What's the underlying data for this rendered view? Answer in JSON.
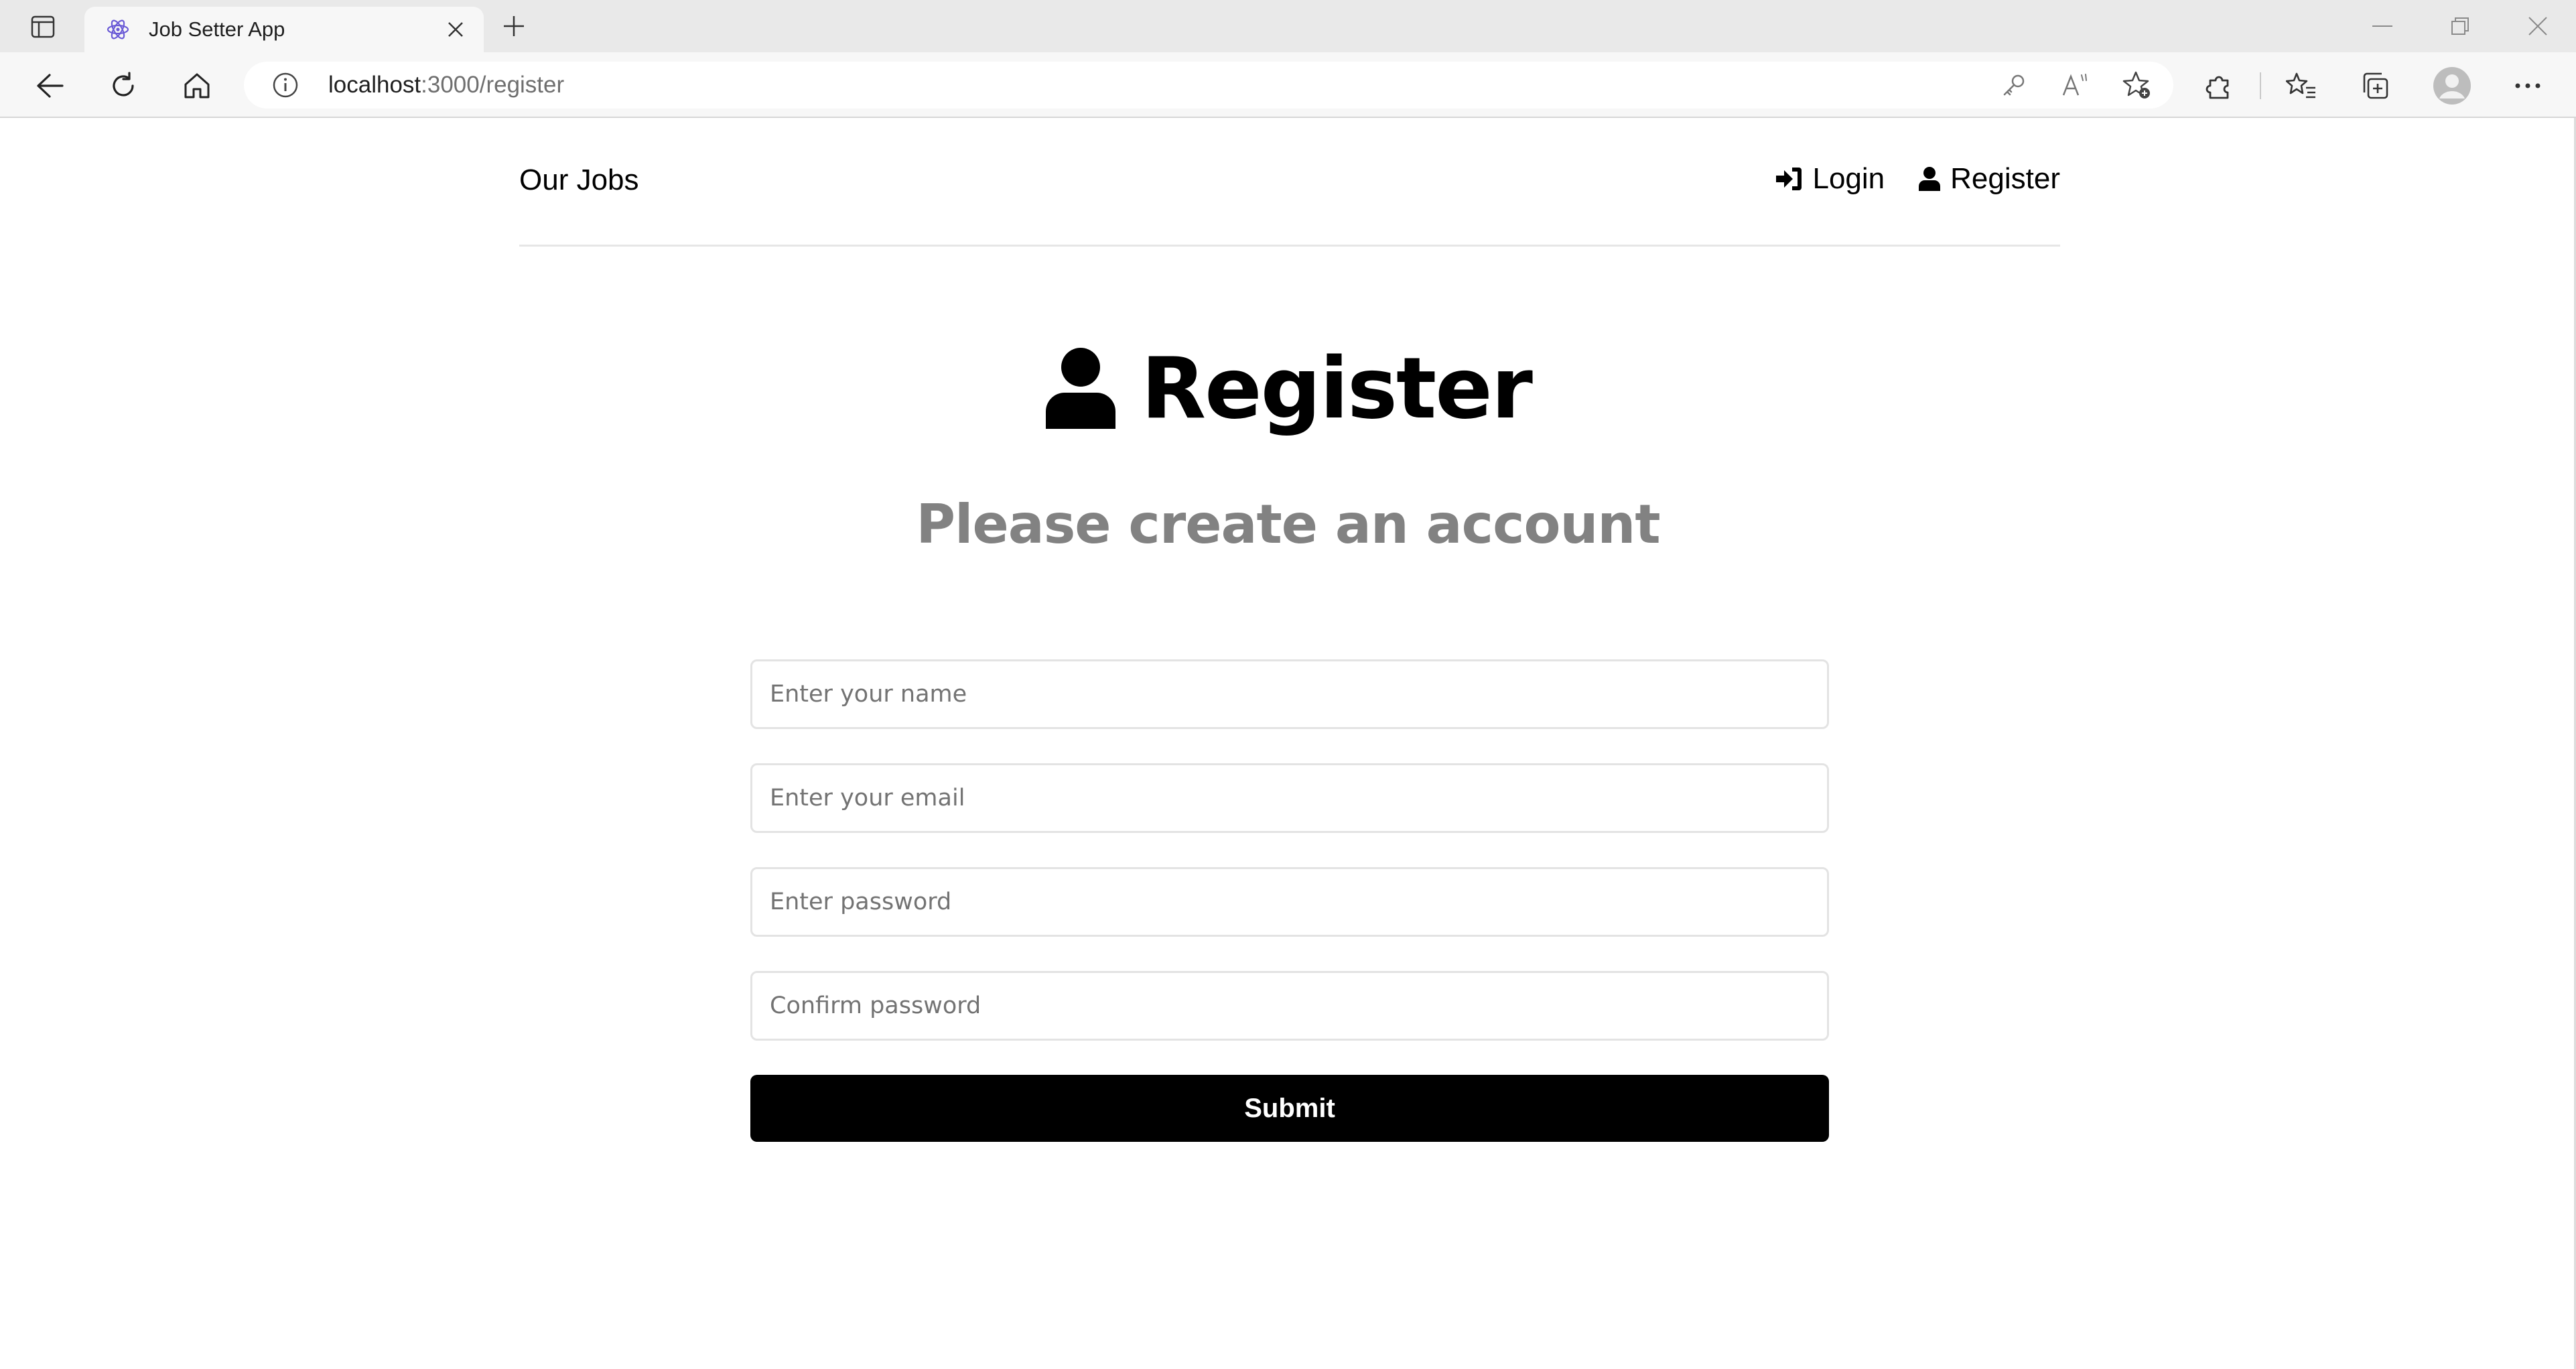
{
  "browser": {
    "tab_title": "Job Setter App",
    "url_host": "localhost",
    "url_path": ":3000/register"
  },
  "nav": {
    "brand": "Our Jobs",
    "login_label": "Login",
    "register_label": "Register"
  },
  "main": {
    "title": "Register",
    "subtitle": "Please create an account"
  },
  "form": {
    "name_placeholder": "Enter your name",
    "email_placeholder": "Enter your email",
    "password_placeholder": "Enter password",
    "confirm_placeholder": "Confirm password",
    "submit_label": "Submit"
  },
  "icons": {
    "login": "sign-in-icon",
    "register": "user-icon"
  },
  "colors": {
    "subtitle": "#828282",
    "button_bg": "#000000",
    "button_text": "#ffffff"
  }
}
